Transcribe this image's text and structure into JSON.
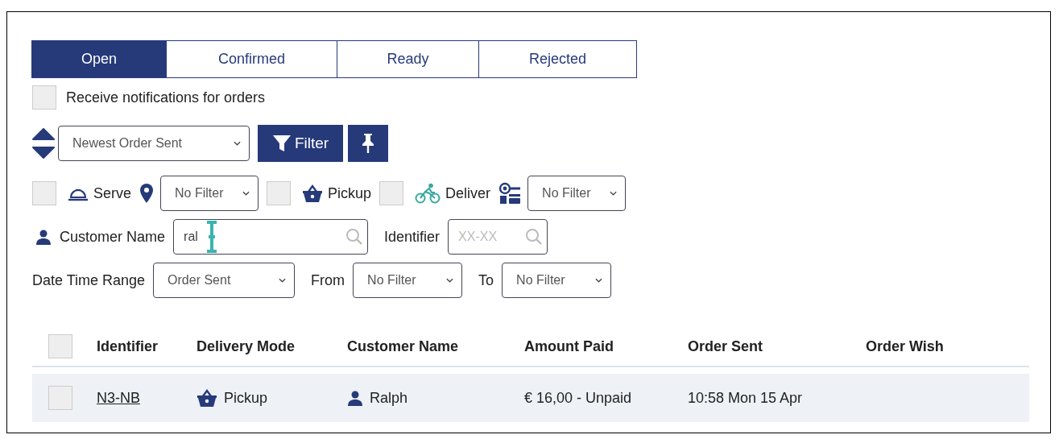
{
  "tabs": [
    {
      "label": "Open",
      "selected": true
    },
    {
      "label": "Confirmed",
      "selected": false
    },
    {
      "label": "Ready",
      "selected": false
    },
    {
      "label": "Rejected",
      "selected": false
    }
  ],
  "notifications": {
    "label": "Receive notifications for orders",
    "checked": false
  },
  "sort": {
    "value": "Newest Order Sent"
  },
  "filter_button": {
    "label": "Filter"
  },
  "delivery_filters": [
    {
      "kind": "serve",
      "label": "Serve",
      "checked": false,
      "select": "No Filter"
    },
    {
      "kind": "pickup",
      "label": "Pickup",
      "checked": false
    },
    {
      "kind": "deliver",
      "label": "Deliver",
      "checked": false,
      "select": "No Filter"
    }
  ],
  "customer_name": {
    "label": "Customer Name",
    "value": "ral"
  },
  "identifier": {
    "label": "Identifier",
    "placeholder": "XX-XX"
  },
  "date_range": {
    "label": "Date Time Range",
    "value": "Order Sent"
  },
  "from": {
    "label": "From",
    "value": "No Filter"
  },
  "to": {
    "label": "To",
    "value": "No Filter"
  },
  "table": {
    "select_all": {
      "checked": false
    },
    "columns": [
      "Identifier",
      "Delivery Mode",
      "Customer Name",
      "Amount Paid",
      "Order Sent",
      "Order Wish"
    ],
    "rows": [
      {
        "selected": false,
        "identifier": "N3-NB",
        "delivery_mode": {
          "kind": "pickup",
          "label": "Pickup"
        },
        "customer_name": "Ralph",
        "amount_paid": "€ 16,00 - Unpaid",
        "order_sent": "10:58 Mon 15 Apr"
      }
    ]
  }
}
